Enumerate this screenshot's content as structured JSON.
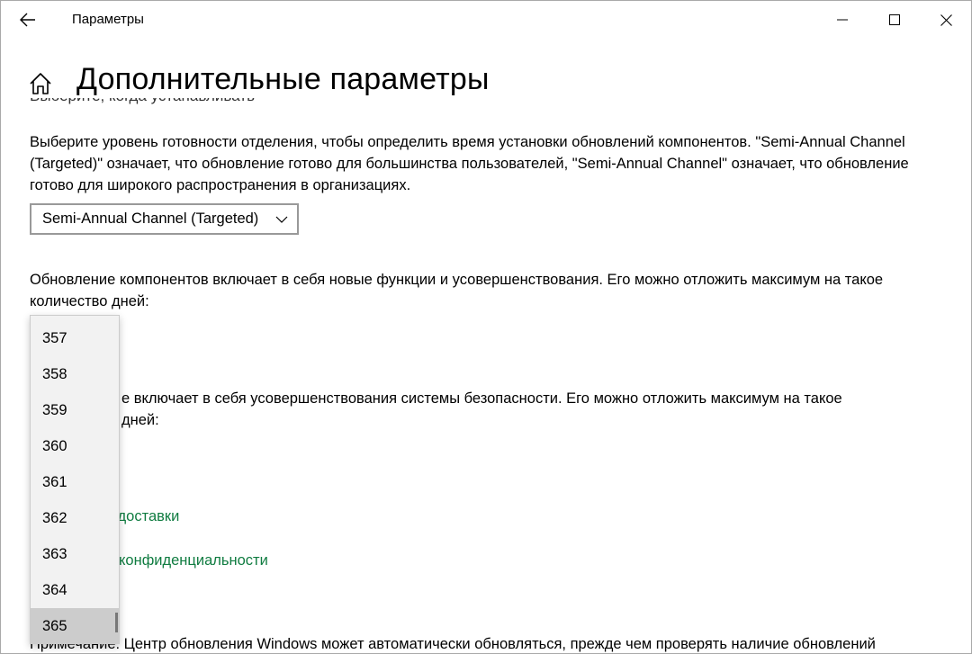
{
  "window": {
    "title": "Параметры"
  },
  "page": {
    "title": "Дополнительные параметры",
    "clipped_text": "Выберите, когда устанавливать"
  },
  "section_readiness": {
    "text": "Выберите уровень готовности отделения, чтобы определить время установки обновлений компонентов. \"Semi-Annual Channel (Targeted)\" означает, что обновление готово для большинства пользователей, \"Semi-Annual Channel\" означает, что обновление готово для широкого распространения в организациях.",
    "select_value": "Semi-Annual Channel (Targeted)"
  },
  "section_feature": {
    "text": "Обновление компонентов включает в себя новые функции и усовершенствования. Его можно отложить максимум на такое количество дней:"
  },
  "section_quality": {
    "text_visible": "е включает в себя усовершенствования системы безопасности. Его можно отложить максимум на такое",
    "text_line2_visible": "дней:"
  },
  "links": {
    "delivery_visible": "я доставки",
    "privacy_visible": "конфиденциальности"
  },
  "note": {
    "text_visible": "Примечание: Центр обновления Windows может автоматически обновляться, прежде чем проверять наличие обновлений"
  },
  "dropdown": {
    "items": [
      "357",
      "358",
      "359",
      "360",
      "361",
      "362",
      "363",
      "364",
      "365"
    ],
    "selected": "365"
  },
  "colors": {
    "link": "#107c41",
    "dropdown_bg": "#f2f2f2",
    "selected_bg": "#cccccc"
  }
}
